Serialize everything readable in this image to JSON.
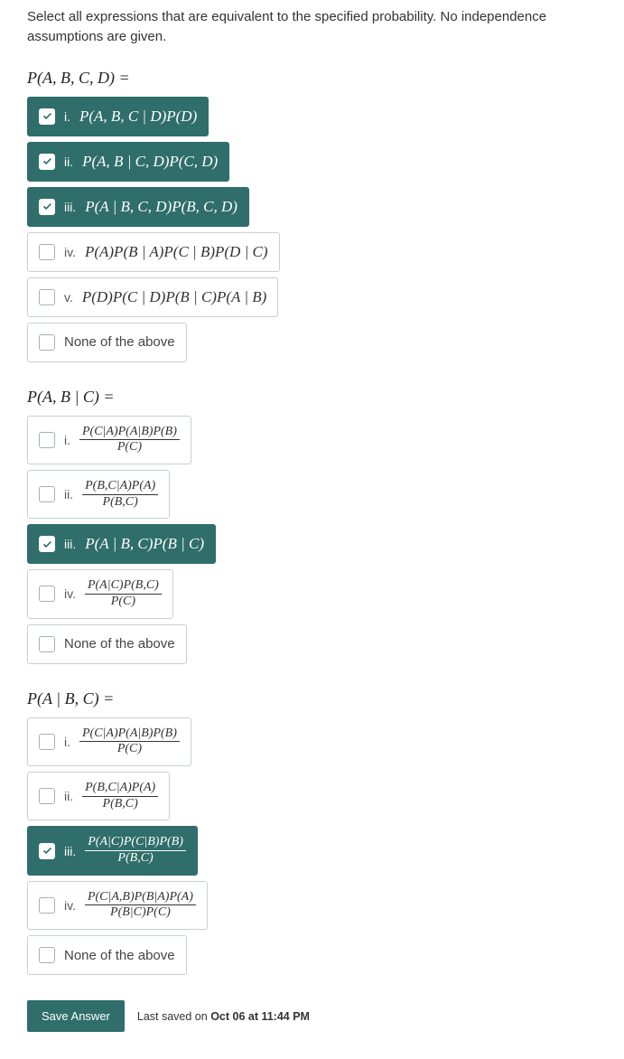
{
  "instructions": "Select all expressions that are equivalent to the specified probability. No independence assumptions are given.",
  "questions": [
    {
      "title_html": "P(A, B, C, D) =",
      "options": [
        {
          "roman": "i.",
          "checked": true,
          "formula_html": "P(A, B, C | D)P(D)"
        },
        {
          "roman": "ii.",
          "checked": true,
          "formula_html": "P(A, B | C, D)P(C, D)"
        },
        {
          "roman": "iii.",
          "checked": true,
          "formula_html": "P(A | B, C, D)P(B, C, D)"
        },
        {
          "roman": "iv.",
          "checked": false,
          "formula_html": "P(A)P(B | A)P(C | B)P(D | C)"
        },
        {
          "roman": "v.",
          "checked": false,
          "formula_html": "P(D)P(C | D)P(B | C)P(A | B)"
        },
        {
          "roman": "",
          "checked": false,
          "none": true,
          "formula_html": "None of the above"
        }
      ]
    },
    {
      "title_html": "P(A, B | C) =",
      "options": [
        {
          "roman": "i.",
          "checked": false,
          "frac_num": "P(C|A)P(A|B)P(B)",
          "frac_den": "P(C)"
        },
        {
          "roman": "ii.",
          "checked": false,
          "frac_num": "P(B,C|A)P(A)",
          "frac_den": "P(B,C)"
        },
        {
          "roman": "iii.",
          "checked": true,
          "formula_html": "P(A | B, C)P(B | C)"
        },
        {
          "roman": "iv.",
          "checked": false,
          "frac_num": "P(A|C)P(B,C)",
          "frac_den": "P(C)"
        },
        {
          "roman": "",
          "checked": false,
          "none": true,
          "formula_html": "None of the above"
        }
      ]
    },
    {
      "title_html": "P(A | B, C) =",
      "options": [
        {
          "roman": "i.",
          "checked": false,
          "frac_num": "P(C|A)P(A|B)P(B)",
          "frac_den": "P(C)"
        },
        {
          "roman": "ii.",
          "checked": false,
          "frac_num": "P(B,C|A)P(A)",
          "frac_den": "P(B,C)"
        },
        {
          "roman": "iii.",
          "checked": true,
          "frac_num": "P(A|C)P(C|B)P(B)",
          "frac_den": "P(B,C)"
        },
        {
          "roman": "iv.",
          "checked": false,
          "frac_num": "P(C|A,B)P(B|A)P(A)",
          "frac_den": "P(B|C)P(C)"
        },
        {
          "roman": "",
          "checked": false,
          "none": true,
          "formula_html": "None of the above"
        }
      ]
    }
  ],
  "footer": {
    "save_label": "Save Answer",
    "last_saved_prefix": "Last saved on ",
    "last_saved_time": "Oct 06 at 11:44 PM"
  }
}
